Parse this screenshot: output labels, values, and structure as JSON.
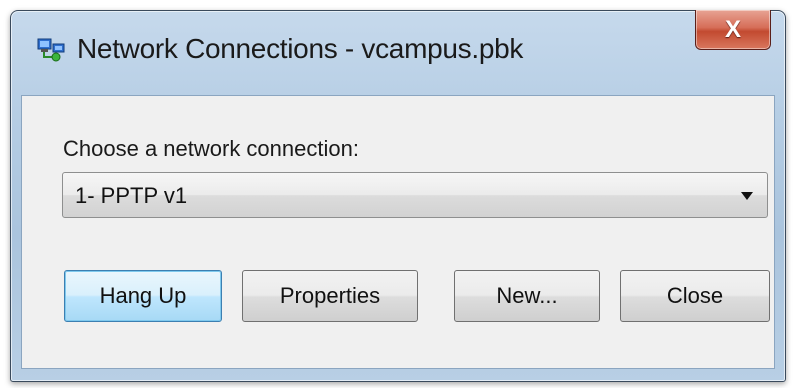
{
  "window": {
    "title": "Network Connections - vcampus.pbk",
    "icon": "network-connections-icon",
    "close_glyph": "X"
  },
  "form": {
    "prompt_label": "Choose a network connection:",
    "selected_connection": "1- PPTP v1"
  },
  "buttons": {
    "hang_up": "Hang Up",
    "properties": "Properties",
    "new": "New...",
    "close": "Close"
  },
  "colors": {
    "close_button_red": "#c24a30",
    "default_button_blue": "#3c7fb1"
  }
}
